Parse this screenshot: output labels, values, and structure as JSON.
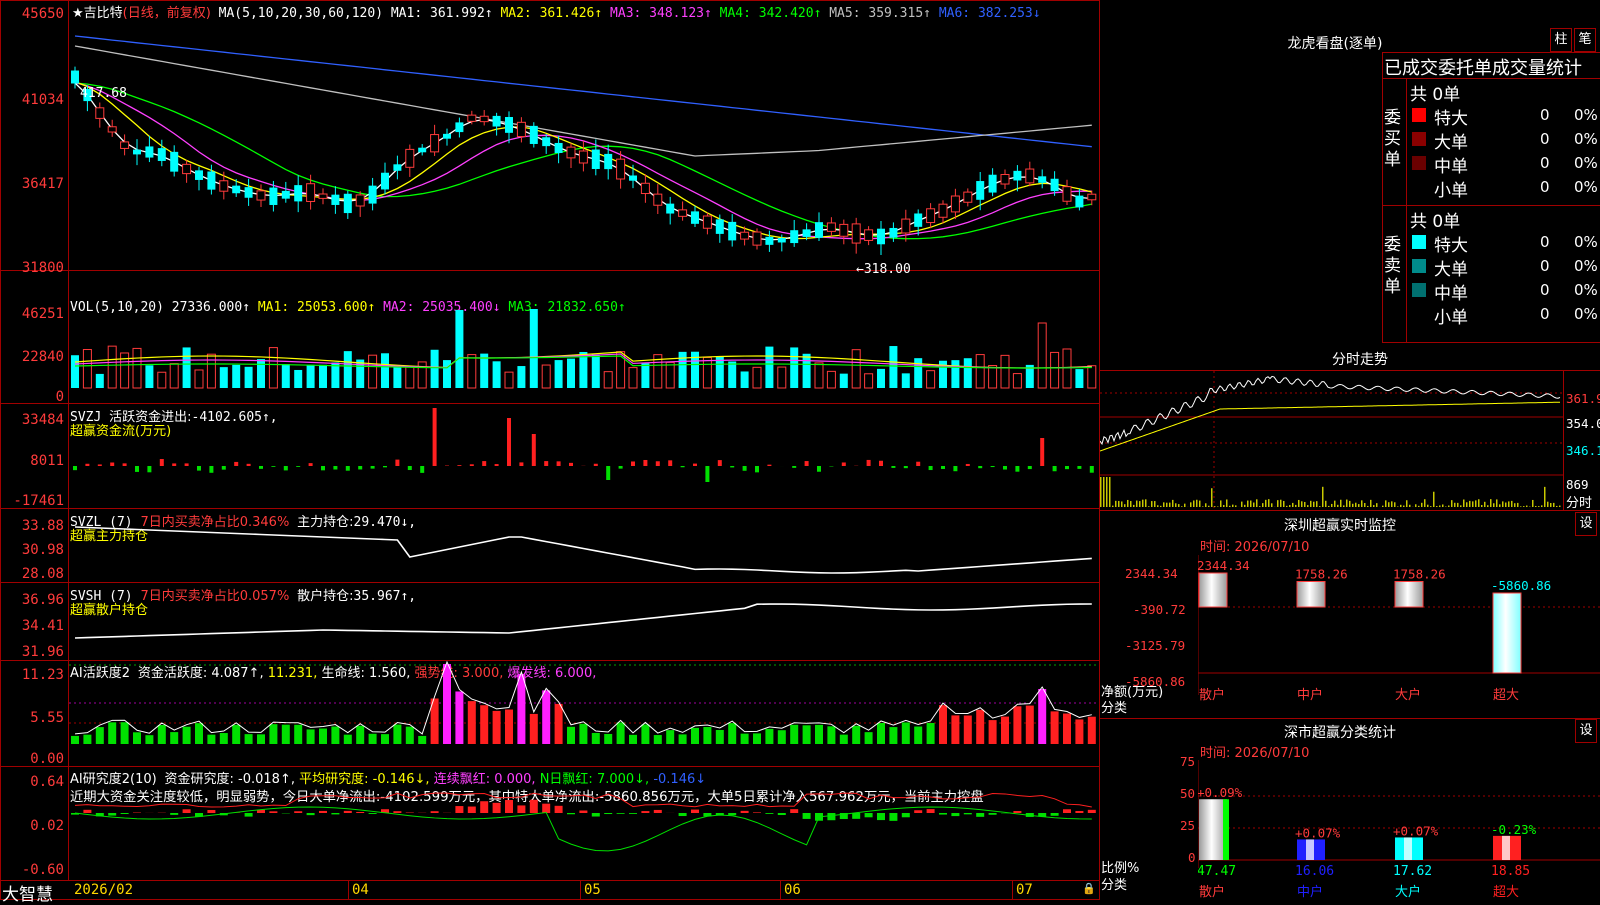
{
  "stock": {
    "name": "吉比特",
    "period": "(日线，前复权)"
  },
  "main": {
    "yticks": [
      "45650",
      "41034",
      "36417",
      "31800"
    ],
    "ma_params": "MA(5,10,20,30,60,120)",
    "ma": [
      {
        "label": "MA1:",
        "value": "361.992↑",
        "color": "#ffffff"
      },
      {
        "label": "MA2:",
        "value": "361.426↑",
        "color": "#ffff00"
      },
      {
        "label": "MA3:",
        "value": "348.123↑",
        "color": "#ff40ff"
      },
      {
        "label": "MA4:",
        "value": "342.420↑",
        "color": "#00ff00"
      },
      {
        "label": "MA5:",
        "value": "359.315↑",
        "color": "#c0c0c0"
      },
      {
        "label": "MA6:",
        "value": "382.253↓",
        "color": "#3060ff"
      }
    ],
    "high_label": "417.68",
    "low_label": "←318.00"
  },
  "vol": {
    "yticks": [
      "46251",
      "22840",
      "0"
    ],
    "params": "VOL(5,10,20)",
    "value": "27336.000↑",
    "ma": [
      {
        "label": "MA1:",
        "value": "25053.600↑",
        "color": "#ffff00"
      },
      {
        "label": "MA2:",
        "value": "25035.400↓",
        "color": "#ff40ff"
      },
      {
        "label": "MA3:",
        "value": "21832.650↑",
        "color": "#00ff00"
      }
    ]
  },
  "svzj": {
    "yticks": [
      "33484",
      "8011",
      "-17461"
    ],
    "name": "SVZJ",
    "label": "活跃资金进出:",
    "value": "-4102.605↑,",
    "sub": "超赢资金流(万元)"
  },
  "svzl": {
    "yticks": [
      "33.88",
      "30.98",
      "28.08"
    ],
    "name": "SVZL (7)",
    "label1": "7日内买卖净占比0.346%",
    "label2": "主力持仓:",
    "value": "29.470↓,",
    "sub": "超赢主力持仓"
  },
  "svsh": {
    "yticks": [
      "36.96",
      "34.41",
      "31.96"
    ],
    "name": "SVSH (7)",
    "label1": "7日内买卖净占比0.057%",
    "label2": "散户持仓:",
    "value": "35.967↑,",
    "sub": "超赢散户持仓"
  },
  "ai1": {
    "yticks": [
      "11.23",
      "5.55",
      "0.00"
    ],
    "name": "AI活跃度2",
    "items": [
      {
        "t": "资金活跃度:",
        "c": "#ffffff"
      },
      {
        "t": "4.087↑,",
        "c": "#ffffff"
      },
      {
        "t": "11.231,",
        "c": "#ffff00"
      },
      {
        "t": "生命线:",
        "c": "#ffffff"
      },
      {
        "t": "1.560,",
        "c": "#ffffff"
      },
      {
        "t": "强势线:",
        "c": "#ff3b3b"
      },
      {
        "t": "3.000,",
        "c": "#ff3b3b"
      },
      {
        "t": "爆发线:",
        "c": "#ff40ff"
      },
      {
        "t": "6.000,",
        "c": "#ff40ff"
      }
    ]
  },
  "ai2": {
    "yticks": [
      "0.64",
      "0.02",
      "-0.60"
    ],
    "name": "AI研究度2(10)",
    "items": [
      {
        "t": "资金研究度:",
        "c": "#ffffff"
      },
      {
        "t": "-0.018↑,",
        "c": "#ffffff"
      },
      {
        "t": "平均研究度:",
        "c": "#ffff00"
      },
      {
        "t": "-0.146↓,",
        "c": "#ffff00"
      },
      {
        "t": "连续飘红:",
        "c": "#ff40ff"
      },
      {
        "t": "0.000,",
        "c": "#ff40ff"
      },
      {
        "t": "N日飘红:",
        "c": "#00ff00"
      },
      {
        "t": "7.000↓,",
        "c": "#00ff00"
      },
      {
        "t": "-0.146↓",
        "c": "#3060ff"
      }
    ],
    "summary": "近期大资金关注度较低，明显弱势，今日大单净流出:-4102.599万元，其中特大单净流出:-5860.856万元，大单5日累计净入567.962万元，当前主力控盘"
  },
  "xaxis": {
    "app": "大智慧",
    "labels": [
      "2026/02",
      "04",
      "05",
      "06",
      "07"
    ]
  },
  "lhb": {
    "title": "龙虎看盘(逐单)",
    "btn1": "柱",
    "btn2": "笔",
    "header": "已成交委托单成交量统计",
    "buy_side": "委买单",
    "sell_side": "委卖单",
    "buy_total": "共 0单",
    "sell_total": "共 0单",
    "buy_rows": [
      {
        "name": "特大",
        "count": "0",
        "pct": "0%",
        "color": "#ff0000"
      },
      {
        "name": "大单",
        "count": "0",
        "pct": "0%",
        "color": "#8b0000"
      },
      {
        "name": "中单",
        "count": "0",
        "pct": "0%",
        "color": "#6a0000"
      },
      {
        "name": "小单",
        "count": "0",
        "pct": "0%",
        "color": "#000000"
      }
    ],
    "sell_rows": [
      {
        "name": "特大",
        "count": "0",
        "pct": "0%",
        "color": "#00ffff"
      },
      {
        "name": "大单",
        "count": "0",
        "pct": "0%",
        "color": "#008b8b"
      },
      {
        "name": "中单",
        "count": "0",
        "pct": "0%",
        "color": "#007070"
      },
      {
        "name": "小单",
        "count": "0",
        "pct": "0%",
        "color": "#000000"
      }
    ]
  },
  "fenshi": {
    "title": "分时走势",
    "yticks": [
      "361.9",
      "354.0",
      "346.1",
      "869",
      "分时"
    ]
  },
  "szmon": {
    "title": "深圳超赢实时监控",
    "btn": "设",
    "time": "时间: 2026/07/10",
    "yticks": [
      "2344.34",
      "-390.72",
      "-3125.79",
      "-5860.86"
    ],
    "unit1": "净额(万元)",
    "unit2": "分类",
    "bars": [
      {
        "cat": "散户",
        "value": "2344.34",
        "v": 2344.34
      },
      {
        "cat": "中户",
        "value": "1758.26",
        "v": 1758.26
      },
      {
        "cat": "大户",
        "value": "1758.26",
        "v": 1758.26
      },
      {
        "cat": "超大",
        "value": "-5860.86",
        "v": -5860.86
      }
    ]
  },
  "szcls": {
    "title": "深市超赢分类统计",
    "btn": "设",
    "time": "时间: 2026/07/10",
    "yticks": [
      "75",
      "50",
      "25",
      "0"
    ],
    "unit1": "比例%",
    "unit2": "分类",
    "bars": [
      {
        "cat": "散户",
        "value": "47.47",
        "chg": "+0.09%",
        "v": 47.47,
        "color": "#c0c0c0"
      },
      {
        "cat": "中户",
        "value": "16.06",
        "chg": "+0.07%",
        "v": 16.06,
        "color": "#2020ff"
      },
      {
        "cat": "大户",
        "value": "17.62",
        "chg": "+0.07%",
        "v": 17.62,
        "color": "#00ffff"
      },
      {
        "cat": "超大",
        "value": "18.85",
        "chg": "-0.23%",
        "v": 18.85,
        "color": "#ff2020"
      }
    ]
  }
}
